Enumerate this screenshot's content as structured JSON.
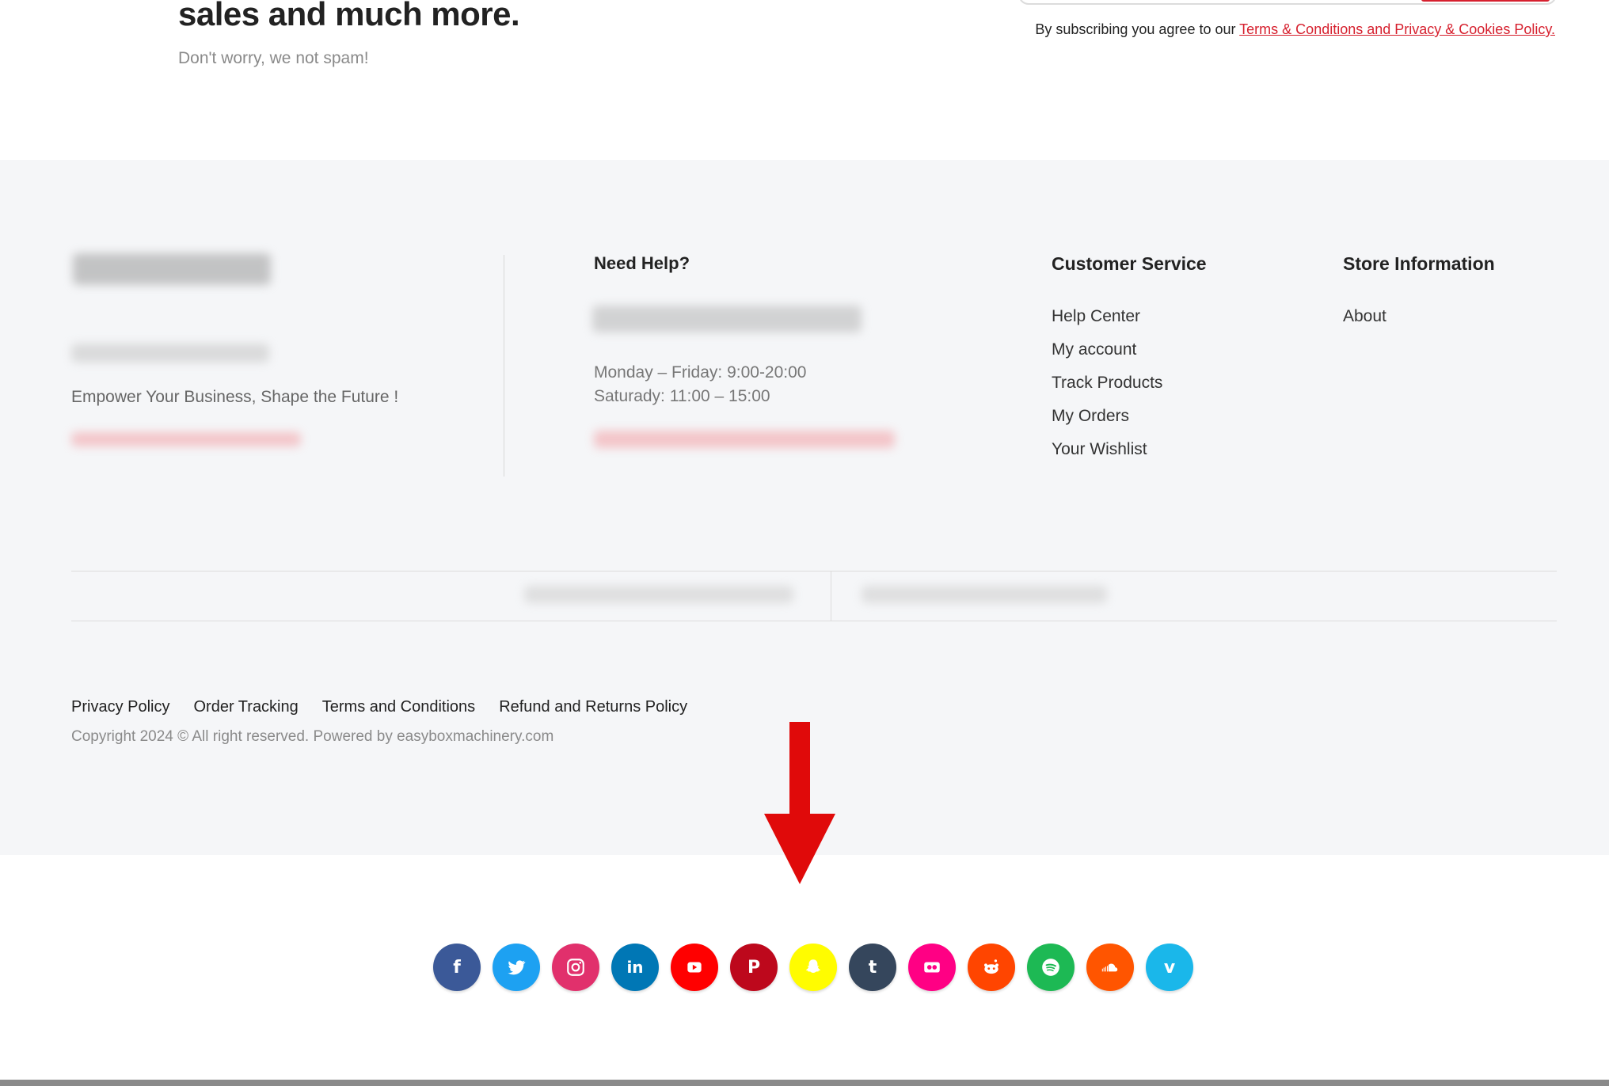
{
  "newsletter": {
    "heading": "sales and much more.",
    "subtext": "Don't worry, we not spam!",
    "terms_prefix": "By subscribing you agree to our ",
    "terms_link": "Terms & Conditions and Privacy & Cookies Policy."
  },
  "footer": {
    "tagline": "Empower Your Business, Shape the Future !",
    "help": {
      "title": "Need Help?",
      "hours_weekday": "Monday – Friday: 9:00-20:00",
      "hours_saturday": "Saturady: 11:00 – 15:00"
    },
    "customer_service": {
      "title": "Customer Service",
      "links": [
        "Help Center",
        "My account",
        "Track Products",
        "My Orders",
        "Your Wishlist"
      ]
    },
    "store_information": {
      "title": "Store Information",
      "links": [
        "About"
      ]
    },
    "legal_links": [
      "Privacy Policy",
      "Order Tracking",
      "Terms and Conditions",
      "Refund and Returns Policy"
    ],
    "copyright": "Copyright 2024 © All right reserved. Powered by easyboxmachinery.com"
  },
  "social": [
    {
      "name": "facebook-icon",
      "color": "#3b5998",
      "glyph": "f"
    },
    {
      "name": "twitter-icon",
      "color": "#1da1f2",
      "glyph": ""
    },
    {
      "name": "instagram-icon",
      "color": "#e1306c",
      "glyph": ""
    },
    {
      "name": "linkedin-icon",
      "color": "#0077b5",
      "glyph": "in"
    },
    {
      "name": "youtube-icon",
      "color": "#ff0000",
      "glyph": ""
    },
    {
      "name": "pinterest-icon",
      "color": "#bd081c",
      "glyph": "P"
    },
    {
      "name": "snapchat-icon",
      "color": "#fffc00",
      "glyph": ""
    },
    {
      "name": "tumblr-icon",
      "color": "#35465c",
      "glyph": "t"
    },
    {
      "name": "flickr-icon",
      "color": "#ff0084",
      "glyph": ""
    },
    {
      "name": "reddit-icon",
      "color": "#ff4500",
      "glyph": ""
    },
    {
      "name": "spotify-icon",
      "color": "#1db954",
      "glyph": ""
    },
    {
      "name": "soundcloud-icon",
      "color": "#ff5500",
      "glyph": ""
    },
    {
      "name": "vimeo-icon",
      "color": "#1ab7ea",
      "glyph": "v"
    }
  ],
  "colors": {
    "accent": "#d6202e",
    "footer_bg": "#f5f6f8",
    "arrow": "#e00a0a"
  }
}
